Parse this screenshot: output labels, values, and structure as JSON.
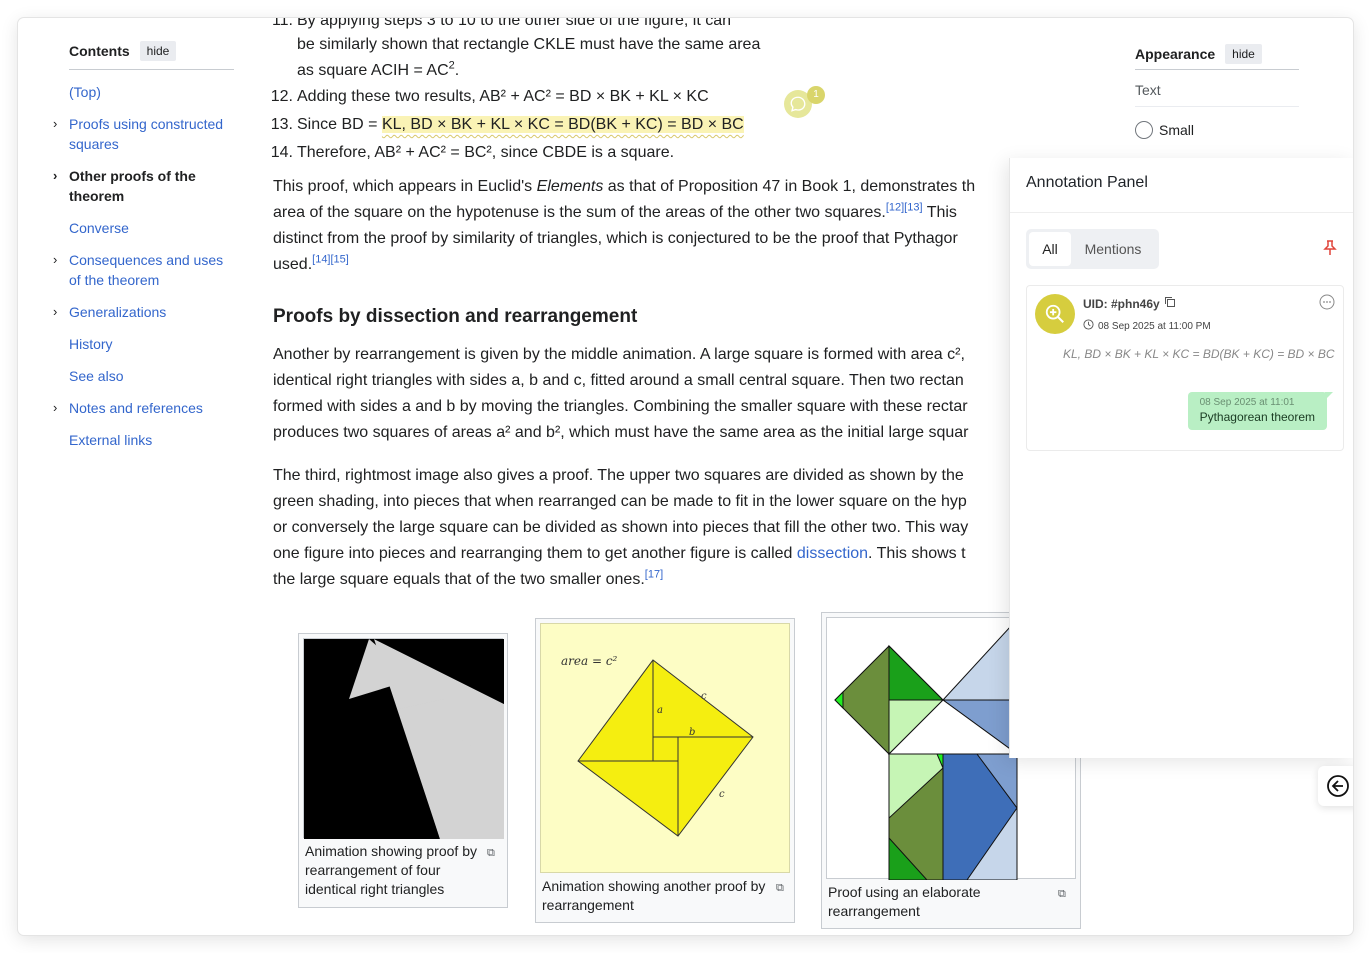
{
  "toc": {
    "title": "Contents",
    "hide_label": "hide",
    "items": [
      {
        "label": "(Top)",
        "expandable": false
      },
      {
        "label": "Proofs using constructed squares",
        "expandable": true
      },
      {
        "label": "Other proofs of the theorem",
        "expandable": true,
        "active": true
      },
      {
        "label": "Converse",
        "expandable": false
      },
      {
        "label": "Consequences and uses of the theorem",
        "expandable": true
      },
      {
        "label": "Generalizations",
        "expandable": true
      },
      {
        "label": "History",
        "expandable": false
      },
      {
        "label": "See also",
        "expandable": false
      },
      {
        "label": "Notes and references",
        "expandable": true
      },
      {
        "label": "External links",
        "expandable": false
      }
    ]
  },
  "article": {
    "step11_num": "11.",
    "step11_l1": "By applying steps 3 to 10 to the other side of the figure, it can",
    "step11_l2": "be similarly shown that rectangle CKLE must have the same area",
    "step11_l3": "as square ACIH = AC",
    "step12_num": "12.",
    "step12": "Adding these two results, AB² + AC² = BD × BK + KL × KC",
    "step13_num": "13.",
    "step13_pre": "Since BD = ",
    "step13_hl": "KL, BD × BK + KL × KC = BD(BK + KC) = BD × BC",
    "step14_num": "14.",
    "step14": "Therefore, AB² + AC² = BC², since CBDE is a square.",
    "p1_l1_a": "This proof, which appears in Euclid's ",
    "p1_l1_em": "Elements",
    "p1_l1_b": " as that of Proposition 47 in Book 1, demonstrates th",
    "p1_l2_a": "area of the square on the hypotenuse is the sum of the areas of the other two squares.",
    "p1_l2_ref": "[12][13]",
    "p1_l2_b": " This",
    "p1_l3": "distinct from the proof by similarity of triangles, which is conjectured to be the proof that Pythagor",
    "p1_l4_a": "used.",
    "p1_l4_ref": "[14][15]",
    "heading": "Proofs by dissection and rearrangement",
    "p2_l1": "Another by rearrangement is given by the middle animation. A large square is formed with area c²,",
    "p2_l2": "identical right triangles with sides a, b and c, fitted around a small central square. Then two rectan",
    "p2_l3": "formed with sides a and b by moving the triangles. Combining the smaller square with these rectar",
    "p2_l4": "produces two squares of areas a² and b², which must have the same area as the initial large squar",
    "p3_l1": "The third, rightmost image also gives a proof. The upper two squares are divided as shown by the",
    "p3_l2": "green shading, into pieces that when rearranged can be made to fit in the lower square on the hyp",
    "p3_l3": "or conversely the large square can be divided as shown into pieces that fill the other two. This way",
    "p3_l4_a": "one figure into pieces and rearranging them to get another figure is called ",
    "p3_l4_link": "dissection",
    "p3_l4_b": ". This shows t",
    "p3_l5_a": "the large square equals that of the two smaller ones.",
    "p3_l5_ref": "[17]",
    "comment_count": "1"
  },
  "figures": {
    "fig1_caption": "Animation showing proof by rearrangement of four identical right triangles",
    "fig2_caption": "Animation showing another proof by rearrangement",
    "fig2_area_label": "area = c²",
    "fig2_a": "a",
    "fig2_b": "b",
    "fig2_c1": "c",
    "fig2_c2": "c",
    "fig3_caption": "Proof using an elaborate rearrangement",
    "enlarge_icon": "enlarge-icon"
  },
  "appearance": {
    "title": "Appearance",
    "hide_label": "hide",
    "text_label": "Text",
    "small_label": "Small"
  },
  "panel": {
    "title": "Annotation Panel",
    "tab_all": "All",
    "tab_mentions": "Mentions",
    "uid": "UID: #phn46y",
    "date": "08 Sep 2025 at 11:00 PM",
    "quote": "KL, BD × BK + KL × KC = BD(BK + KC) = BD × BC",
    "tag_date": "08 Sep 2025 at 11:01",
    "tag_label": "Pythagorean theorem",
    "colors": {
      "accent": "#d6cd3e",
      "tag": "#b9efc4",
      "pin": "#e0443a",
      "highlight": "#faf3b5"
    }
  }
}
